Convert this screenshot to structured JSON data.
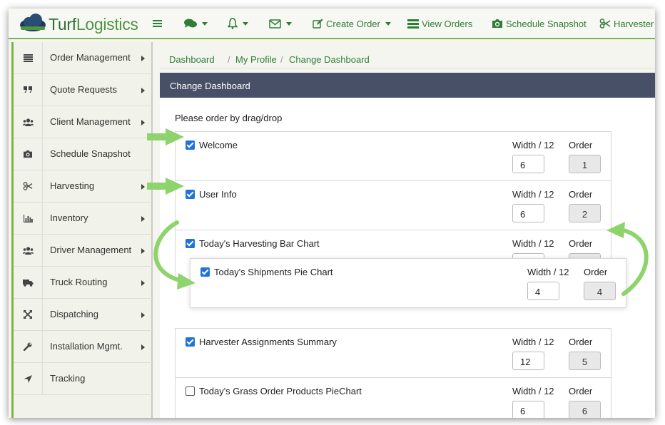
{
  "app": {
    "brand_a": "Turf",
    "brand_b": "Logistics"
  },
  "topnav": {
    "menu_icon": "hamburger-icon",
    "items": [
      {
        "icon": "comments-icon",
        "label": ""
      },
      {
        "icon": "bell-icon",
        "label": ""
      },
      {
        "icon": "envelope-icon",
        "label": ""
      },
      {
        "icon": "edit-icon",
        "label": "Create Order"
      },
      {
        "icon": "list-icon",
        "label": "View Orders"
      },
      {
        "icon": "camera-icon",
        "label": "Schedule Snapshot"
      },
      {
        "icon": "scissors-icon",
        "label": "Harvester"
      }
    ]
  },
  "sidebar": {
    "items": [
      {
        "label": "Order Management",
        "icon": "list-icon",
        "submenu": true
      },
      {
        "label": "Quote Requests",
        "icon": "quote-icon",
        "submenu": true
      },
      {
        "label": "Client Management",
        "icon": "users-icon",
        "submenu": true
      },
      {
        "label": "Schedule Snapshot",
        "icon": "camera-icon",
        "submenu": false
      },
      {
        "label": "Harvesting",
        "icon": "scissors-icon",
        "submenu": true
      },
      {
        "label": "Inventory",
        "icon": "bar-chart-icon",
        "submenu": true
      },
      {
        "label": "Driver Management",
        "icon": "users-icon",
        "submenu": true
      },
      {
        "label": "Truck Routing",
        "icon": "truck-icon",
        "submenu": true
      },
      {
        "label": "Dispatching",
        "icon": "arrows-icon",
        "submenu": true
      },
      {
        "label": "Installation Mgmt.",
        "icon": "wrench-icon",
        "submenu": true
      },
      {
        "label": "Tracking",
        "icon": "location-arrow-icon",
        "submenu": false
      }
    ]
  },
  "breadcrumb": {
    "items": [
      "Dashboard",
      "My Profile",
      "Change Dashboard"
    ],
    "separator": "/"
  },
  "panel": {
    "title": "Change Dashboard",
    "instructions": "Please order by drag/drop",
    "width_label": "Width / 12",
    "order_label": "Order",
    "widgets": [
      {
        "title": "Welcome",
        "checked": true,
        "width": "6",
        "order": "1"
      },
      {
        "title": "User Info",
        "checked": true,
        "width": "6",
        "order": "2"
      },
      {
        "title": "Today's Harvesting Bar Chart",
        "checked": true,
        "width": "",
        "order": ""
      },
      {
        "title": "Today's Shipments Pie Chart",
        "checked": true,
        "width": "4",
        "order": "4"
      },
      {
        "title": "Harvester Assignments Summary",
        "checked": true,
        "width": "12",
        "order": "5"
      },
      {
        "title": "Today's Grass Order Products PieChart",
        "checked": false,
        "width": "6",
        "order": "6"
      }
    ]
  },
  "colors": {
    "brand_green": "#2f7d35",
    "accent_green": "#7fb24a",
    "panel_header": "#485068",
    "annotation_arrow": "#8fd36d",
    "checkbox_blue": "#1f73d9"
  }
}
